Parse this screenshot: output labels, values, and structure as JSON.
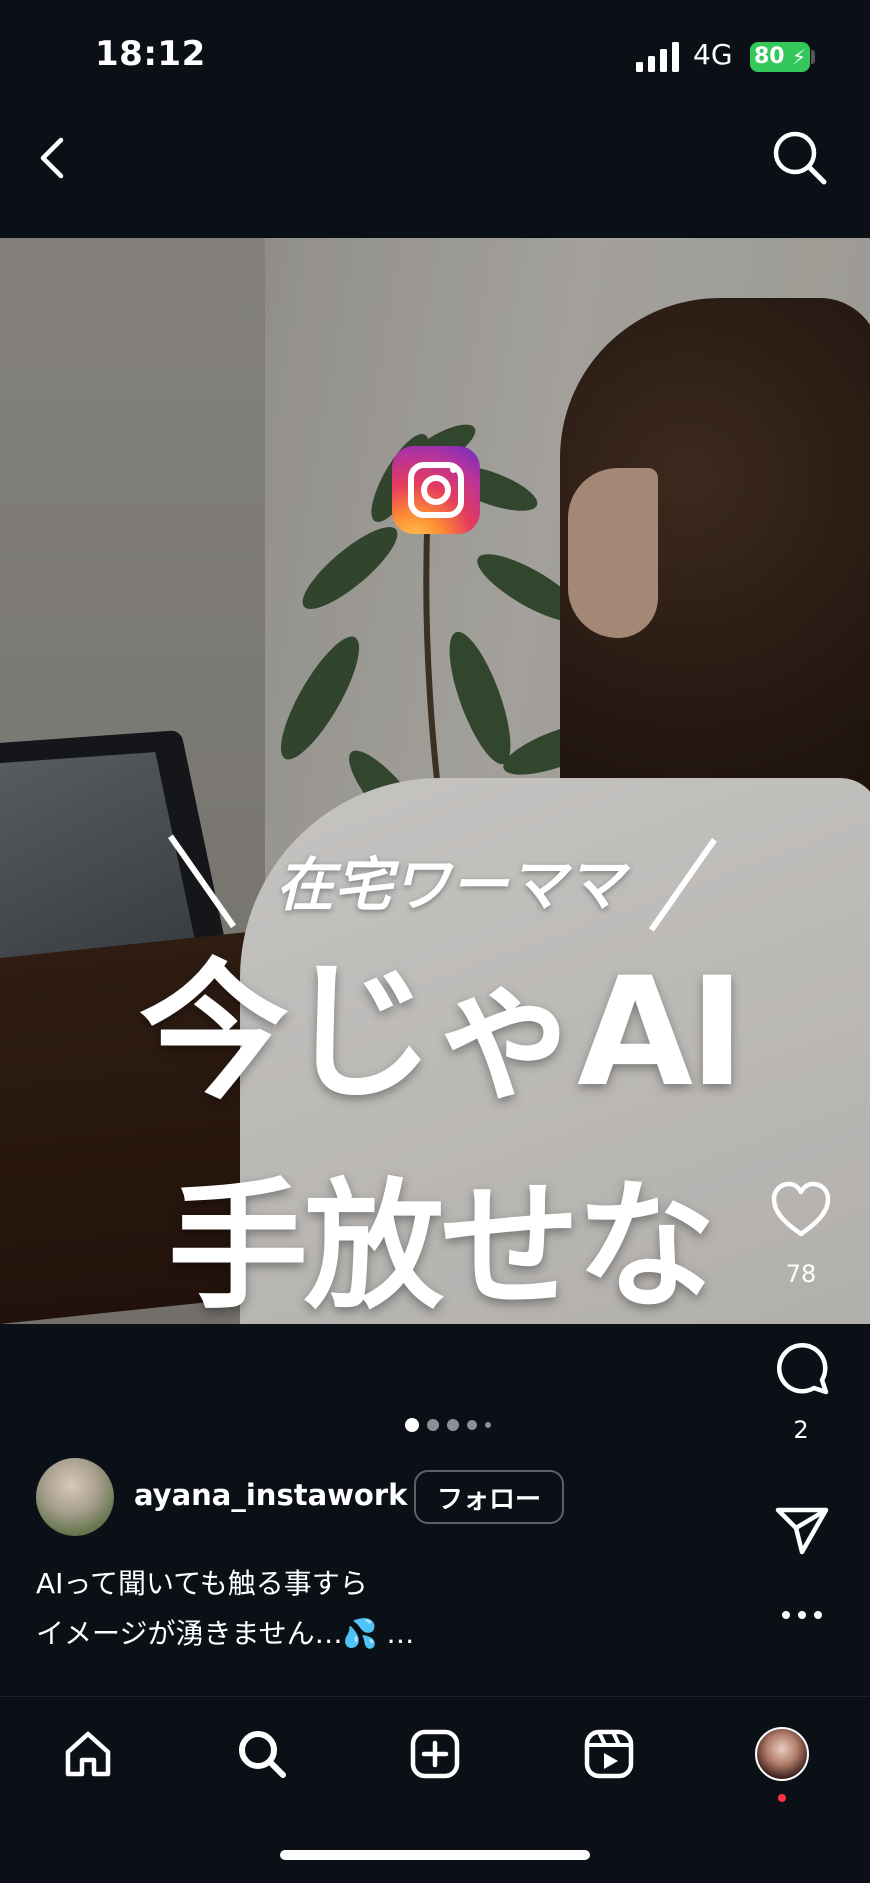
{
  "status_bar": {
    "time": "18:12",
    "network": "4G",
    "battery": "80"
  },
  "post": {
    "image_text": {
      "subtitle": "在宅ワーママ",
      "headline_line1": "今じゃAI",
      "headline_line2": "手放せない!"
    },
    "likes": "78",
    "comments": "2",
    "carousel": {
      "total": 5,
      "active": 1
    },
    "author": {
      "username": "ayana_instawork",
      "follow_label": "フォロー"
    },
    "caption": {
      "line1": "AIって聞いても触る事すら",
      "line2": "イメージが湧きません…💦 …"
    }
  },
  "icons": {
    "back": "chevron-left-icon",
    "search": "search-icon",
    "like": "heart-icon",
    "comment": "comment-icon",
    "share": "send-icon",
    "more": "more-icon",
    "nav": [
      "home-icon",
      "search-icon",
      "create-icon",
      "reels-icon",
      "profile-avatar"
    ]
  },
  "colors": {
    "background": "#0b1017",
    "battery": "#34c759",
    "notification_dot": "#ff3040"
  }
}
